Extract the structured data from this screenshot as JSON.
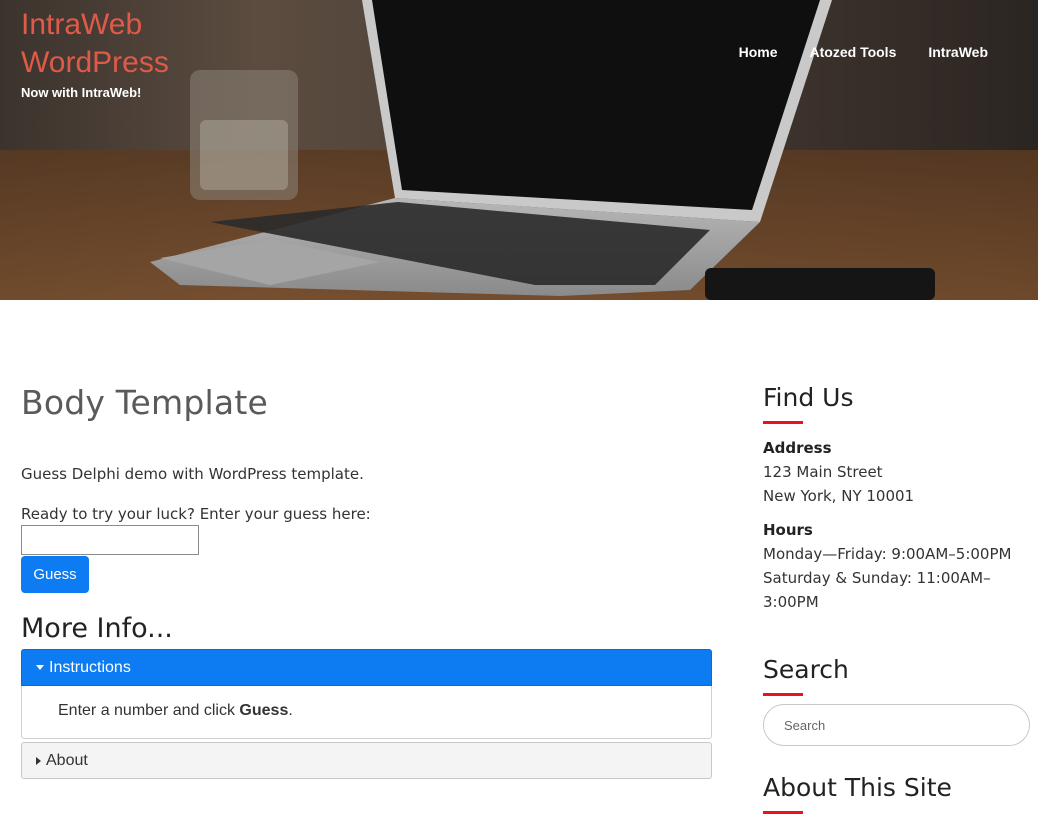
{
  "site": {
    "title": "IntraWeb WordPress",
    "tagline": "Now with IntraWeb!",
    "title_color": "#e05a4a"
  },
  "nav": {
    "items": [
      {
        "label": "Home"
      },
      {
        "label": "Atozed Tools"
      },
      {
        "label": "IntraWeb"
      }
    ]
  },
  "main": {
    "page_title": "Body Template",
    "intro": "Guess Delphi demo with WordPress template.",
    "prompt": "Ready to try your luck? Enter your guess here:",
    "guess_value": "",
    "guess_button": "Guess",
    "more_info_heading": "More Info...",
    "accordion": [
      {
        "label": "Instructions",
        "expanded": true,
        "body_prefix": "Enter a number and click ",
        "body_strong": "Guess",
        "body_suffix": "."
      },
      {
        "label": "About",
        "expanded": false
      }
    ],
    "accent_color": "#0d7bf2"
  },
  "sidebar": {
    "find_us": {
      "title": "Find Us",
      "address_label": "Address",
      "address_line1": "123 Main Street",
      "address_line2": "New York, NY 10001",
      "hours_label": "Hours",
      "hours_line1": "Monday—Friday: 9:00AM–5:00PM",
      "hours_line2": "Saturday & Sunday: 11:00AM–3:00PM"
    },
    "search": {
      "title": "Search",
      "placeholder": "Search"
    },
    "about": {
      "title": "About This Site"
    },
    "underline_color": "#e8121e"
  }
}
